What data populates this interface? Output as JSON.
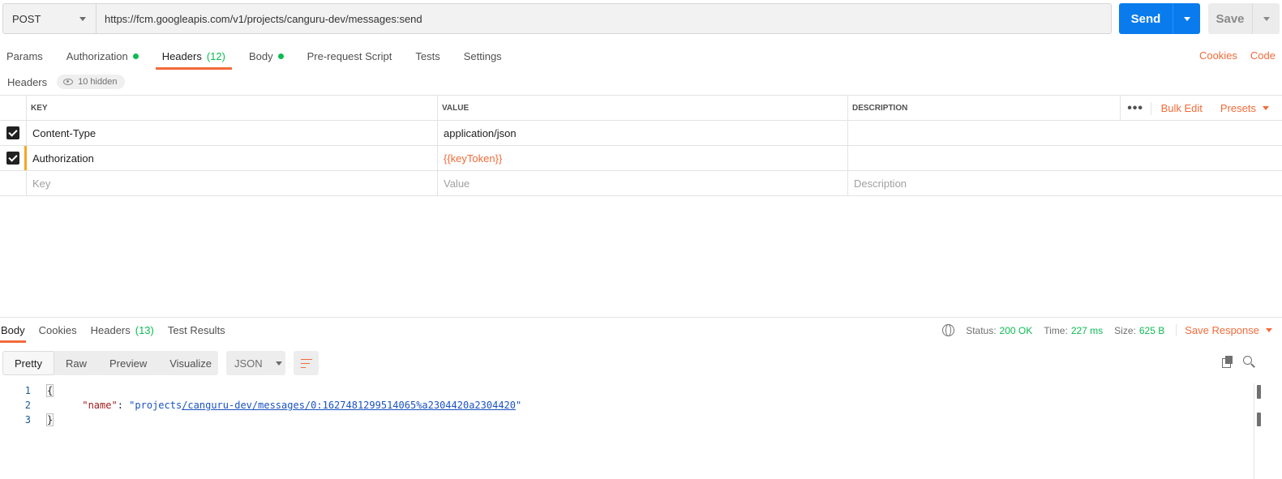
{
  "request": {
    "method": "POST",
    "url": "https://fcm.googleapis.com/v1/projects/canguru-dev/messages:send",
    "send_label": "Send",
    "save_label": "Save"
  },
  "req_tabs": [
    {
      "label": "Params"
    },
    {
      "label": "Authorization",
      "dot": true
    },
    {
      "label": "Headers",
      "count": "(12)",
      "active": true
    },
    {
      "label": "Body",
      "dot": true
    },
    {
      "label": "Pre-request Script"
    },
    {
      "label": "Tests"
    },
    {
      "label": "Settings"
    }
  ],
  "right_links": {
    "cookies": "Cookies",
    "code": "Code"
  },
  "headers_section": {
    "title": "Headers",
    "hidden": "10 hidden"
  },
  "table": {
    "columns": {
      "key": "KEY",
      "value": "VALUE",
      "description": "DESCRIPTION"
    },
    "bulk_edit": "Bulk Edit",
    "presets": "Presets",
    "more": "•••",
    "rows": [
      {
        "key": "Content-Type",
        "value": "application/json",
        "description": ""
      },
      {
        "key": "Authorization",
        "value": "{{keyToken}}",
        "description": ""
      }
    ],
    "placeholders": {
      "key": "Key",
      "value": "Value",
      "description": "Description"
    }
  },
  "resp_tabs": [
    {
      "label": "Body",
      "active": true
    },
    {
      "label": "Cookies"
    },
    {
      "label": "Headers",
      "count": "(13)"
    },
    {
      "label": "Test Results"
    }
  ],
  "response_meta": {
    "status_label": "Status:",
    "status": "200 OK",
    "time_label": "Time:",
    "time": "227 ms",
    "size_label": "Size:",
    "size": "625 B",
    "save_response": "Save Response"
  },
  "view_modes": [
    "Pretty",
    "Raw",
    "Preview",
    "Visualize"
  ],
  "format": "JSON",
  "code": {
    "line_numbers": [
      "1",
      "2",
      "3"
    ],
    "open_brace": "{",
    "key": "\"name\"",
    "colon": ": ",
    "value_prefix": "\"projects",
    "value_link": "/canguru-dev/messages/0:1627481299514065%a2304420a2304420",
    "value_suffix": "\"",
    "close_brace": "}"
  },
  "colors": {
    "accent": "#f26b3a",
    "send": "#097bed",
    "success": "#0cbb52"
  },
  "icons": [
    "chevron-down-icon",
    "eye-icon",
    "globe-icon",
    "wrap-lines-icon",
    "copy-icon",
    "search-icon",
    "checkbox-checked-icon",
    "more-icon"
  ]
}
